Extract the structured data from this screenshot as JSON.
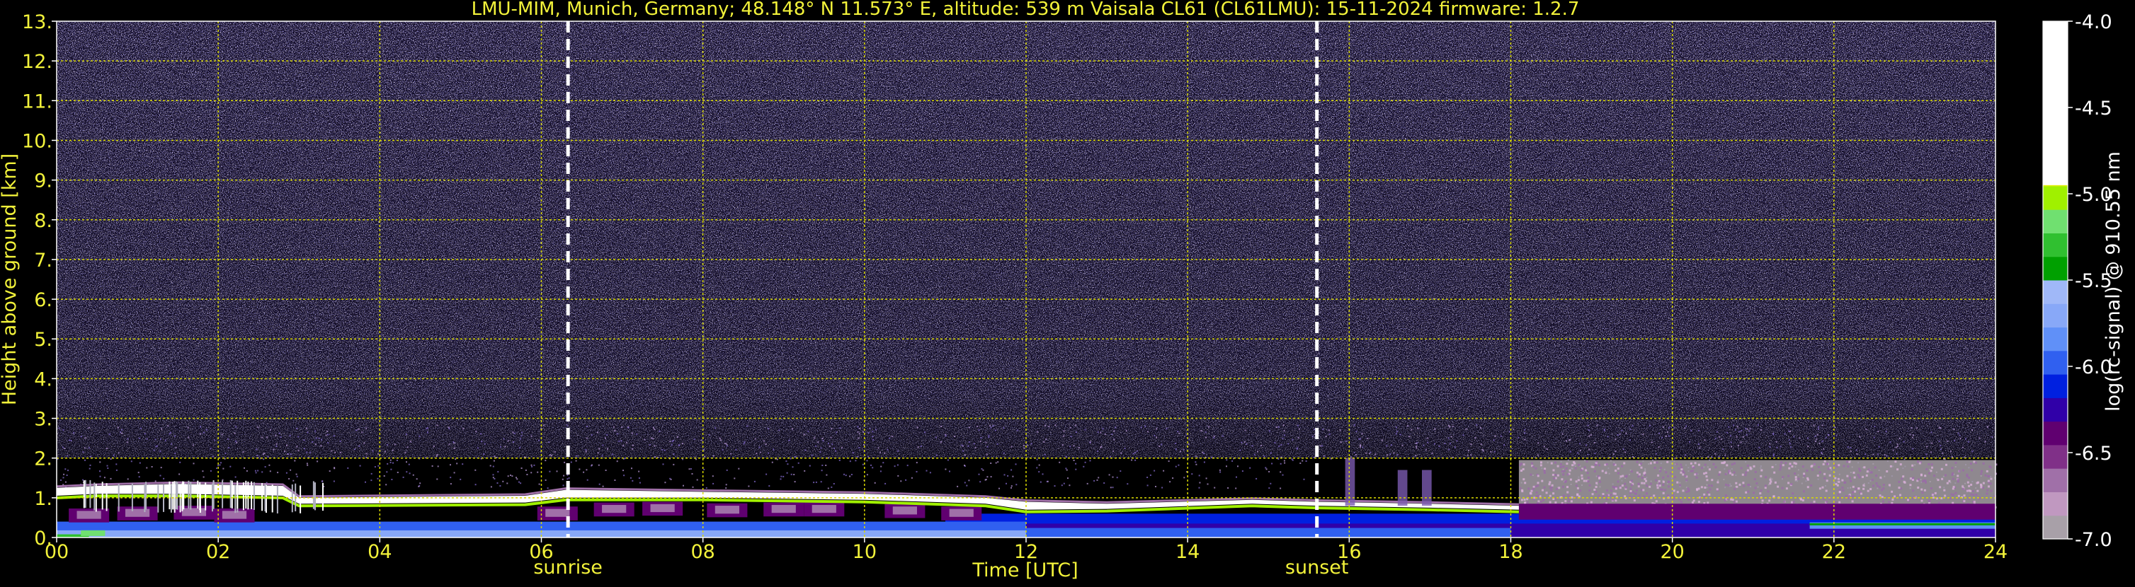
{
  "chart_data": {
    "type": "heatmap",
    "title": "LMU-MIM, Munich, Germany; 48.148° N 11.573° E, altitude: 539 m    Vaisala CL61 (CL61LMU): 15-11-2024    firmware: 1.2.7",
    "xlabel": "Time [UTC]",
    "ylabel": "Height above ground [km]",
    "xlim": [
      0,
      24
    ],
    "ylim": [
      0,
      13
    ],
    "x_ticks": [
      {
        "value": 0,
        "label": "00"
      },
      {
        "value": 2,
        "label": "02"
      },
      {
        "value": 4,
        "label": "04"
      },
      {
        "value": 6,
        "label": "06"
      },
      {
        "value": 8,
        "label": "08"
      },
      {
        "value": 10,
        "label": "10"
      },
      {
        "value": 12,
        "label": "12"
      },
      {
        "value": 14,
        "label": "14"
      },
      {
        "value": 16,
        "label": "16"
      },
      {
        "value": 18,
        "label": "18"
      },
      {
        "value": 20,
        "label": "20"
      },
      {
        "value": 22,
        "label": "22"
      },
      {
        "value": 24,
        "label": "24"
      }
    ],
    "y_ticks": [
      {
        "value": 0,
        "label": "0."
      },
      {
        "value": 1,
        "label": "1."
      },
      {
        "value": 2,
        "label": "2."
      },
      {
        "value": 3,
        "label": "3."
      },
      {
        "value": 4,
        "label": "4."
      },
      {
        "value": 5,
        "label": "5."
      },
      {
        "value": 6,
        "label": "6."
      },
      {
        "value": 7,
        "label": "7."
      },
      {
        "value": 8,
        "label": "8."
      },
      {
        "value": 9,
        "label": "9."
      },
      {
        "value": 10,
        "label": "10."
      },
      {
        "value": 11,
        "label": "11."
      },
      {
        "value": 12,
        "label": "12."
      },
      {
        "value": 13,
        "label": "13."
      }
    ],
    "grid": true,
    "events": [
      {
        "name": "sunrise",
        "time": 6.33
      },
      {
        "name": "sunset",
        "time": 15.6
      }
    ],
    "colorbar": {
      "label": "log(rc-signal) @ 910.55 nm",
      "range": [
        -7.0,
        -4.0
      ],
      "ticks": [
        {
          "value": -4.0,
          "label": "-4.0"
        },
        {
          "value": -4.5,
          "label": "-4.5"
        },
        {
          "value": -5.0,
          "label": "-5.0"
        },
        {
          "value": -5.5,
          "label": "-5.5"
        },
        {
          "value": -6.0,
          "label": "-6.0"
        },
        {
          "value": -6.5,
          "label": "-6.5"
        },
        {
          "value": -7.0,
          "label": "-7.0"
        }
      ],
      "colors_low_to_high": [
        "#a8a0a8",
        "#c098c0",
        "#a070a8",
        "#803088",
        "#600070",
        "#3000a8",
        "#0020e0",
        "#3060f0",
        "#6090f8",
        "#88a8f8",
        "#a0b8f8",
        "#00a000",
        "#30c030",
        "#70e070",
        "#a0f000",
        "#e0f000",
        "#ffc000",
        "#ff8000",
        "#ff4000",
        "#ff0000",
        "#f0c8c8",
        "#ffffff"
      ]
    },
    "signal_layers": [
      {
        "name": "free-troposphere-noise",
        "time_range": [
          0,
          24
        ],
        "height_range_km": [
          2.0,
          13.0
        ],
        "log_signal": -6.4
      },
      {
        "name": "boundary-layer-top-cloud",
        "time_range": [
          0,
          18.1
        ],
        "height_range_km": [
          0.85,
          1.25
        ],
        "log_signal": -4.2
      },
      {
        "name": "morning-aerosol-layer",
        "time_range": [
          0,
          12.0
        ],
        "height_range_km": [
          0.35,
          0.85
        ],
        "log_signal": -6.2
      },
      {
        "name": "afternoon-mixed-layer",
        "time_range": [
          11.0,
          24
        ],
        "height_range_km": [
          0.0,
          0.6
        ],
        "log_signal": -5.9
      },
      {
        "name": "night-residual-layer",
        "time_range": [
          18.1,
          24
        ],
        "height_range_km": [
          0.6,
          1.95
        ],
        "log_signal": -6.8
      }
    ]
  }
}
